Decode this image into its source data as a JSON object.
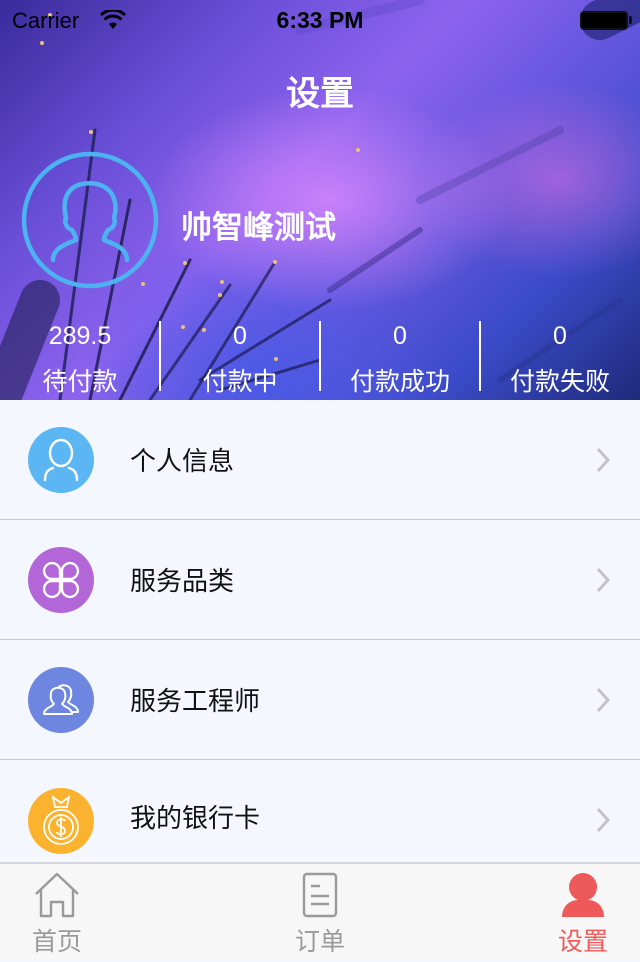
{
  "status_bar": {
    "carrier": "Carrier",
    "time": "6:33 PM",
    "wifi_icon": "wifi-icon",
    "battery_icon": "battery-icon"
  },
  "header": {
    "title": "设置",
    "avatar_icon": "user-avatar-icon",
    "user_name": "帅智峰测试"
  },
  "stats": [
    {
      "value": "289.5",
      "label": "待付款"
    },
    {
      "value": "0",
      "label": "付款中"
    },
    {
      "value": "0",
      "label": "付款成功"
    },
    {
      "value": "0",
      "label": "付款失败"
    }
  ],
  "menu": {
    "items": [
      {
        "label": "个人信息",
        "icon": "person-icon",
        "color": "#5bb6f3"
      },
      {
        "label": "服务品类",
        "icon": "category-icon",
        "color": "#b266d8"
      },
      {
        "label": "服务工程师",
        "icon": "engineers-icon",
        "color": "#6f86e0"
      },
      {
        "label": "我的银行卡",
        "icon": "money-bag-icon",
        "color": "#fbb22e"
      }
    ]
  },
  "tabbar": {
    "tabs": [
      {
        "label": "首页",
        "icon": "home-icon",
        "active": false
      },
      {
        "label": "订单",
        "icon": "order-icon",
        "active": false
      },
      {
        "label": "设置",
        "icon": "profile-icon",
        "active": true
      }
    ],
    "active_color": "#ee5a5a",
    "inactive_color": "#9a9a9a"
  }
}
